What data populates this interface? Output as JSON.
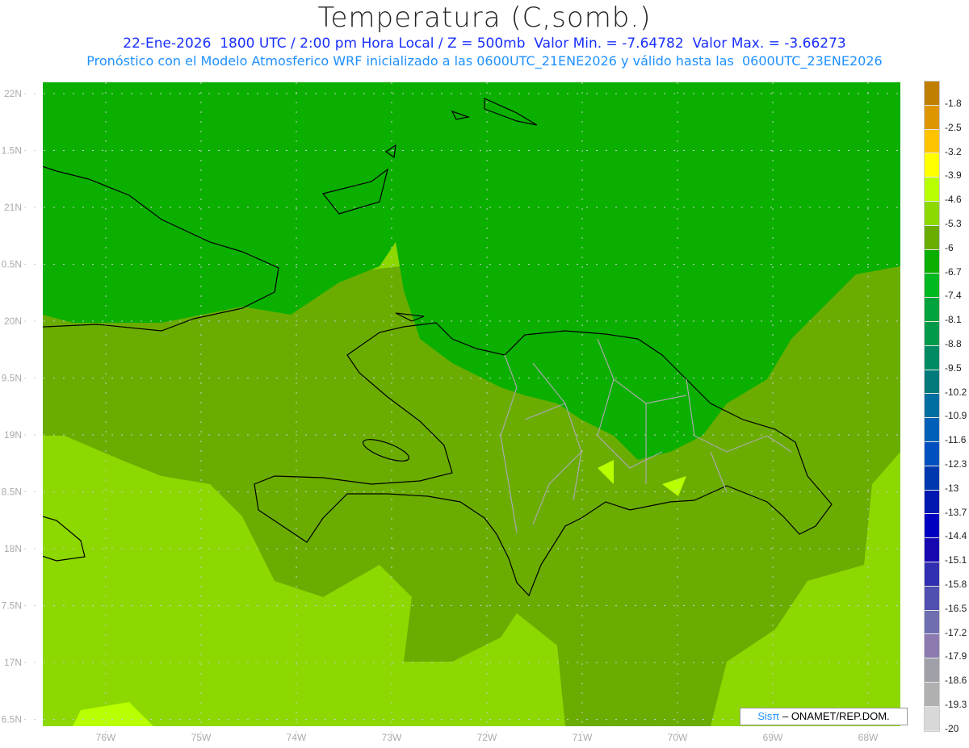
{
  "header": {
    "title": "Temperatura (C,somb.)",
    "line1": "22-Ene-2026  1800 UTC / 2:00 pm Hora Local / Z = 500mb  Valor Min. = -7.64782  Valor Max. = -3.66273",
    "line2": "Pronóstico con el Modelo Atmosferico WRF inicializado a las 0600UTC_21ENE2026 y válido hasta las  0600UTC_23ENE2026"
  },
  "map": {
    "lat_labels": [
      "22N",
      "1.5N",
      "21N",
      "0.5N",
      "20N",
      "9.5N",
      "19N",
      "8.5N",
      "18N",
      "7.5N",
      "17N",
      "6.5N"
    ],
    "lon_labels": [
      "76W",
      "75W",
      "74W",
      "73W",
      "72W",
      "71W",
      "70W",
      "69W",
      "68W"
    ],
    "field_colors": {
      "dark": "#0aaf00",
      "mid": "#6aad00",
      "light": "#8cd800",
      "bright": "#b8ff00"
    }
  },
  "colorbar": {
    "colors": [
      "#c07f00",
      "#dd9600",
      "#ffc300",
      "#ffff00",
      "#b8ff00",
      "#8cd800",
      "#6aad00",
      "#0aaf00",
      "#00b820",
      "#00a33c",
      "#009a4a",
      "#008a64",
      "#007a7a",
      "#006ea0",
      "#0060b8",
      "#0050c0",
      "#0038b0",
      "#0018b0",
      "#0000c0",
      "#1808b0",
      "#3030b0",
      "#5050b0",
      "#6e6eb0",
      "#8c7ab0",
      "#a0a0a8",
      "#b0b0b0",
      "#d8d8d8",
      "#ffffff"
    ],
    "labels": [
      "-1.8",
      "-2.5",
      "-3.2",
      "-3.9",
      "-4.6",
      "-5.3",
      "-6",
      "-6.7",
      "-7.4",
      "-8.1",
      "-8.8",
      "-9.5",
      "-10.2",
      "-10.9",
      "-11.6",
      "-12.3",
      "-13",
      "-13.7",
      "-14.4",
      "-15.1",
      "-15.8",
      "-16.5",
      "-17.2",
      "-17.9",
      "-18.6",
      "-19.3",
      "-20"
    ]
  },
  "credit": {
    "brand": "Sisπ",
    "text": " –  ONAMET/REP.DOM."
  }
}
